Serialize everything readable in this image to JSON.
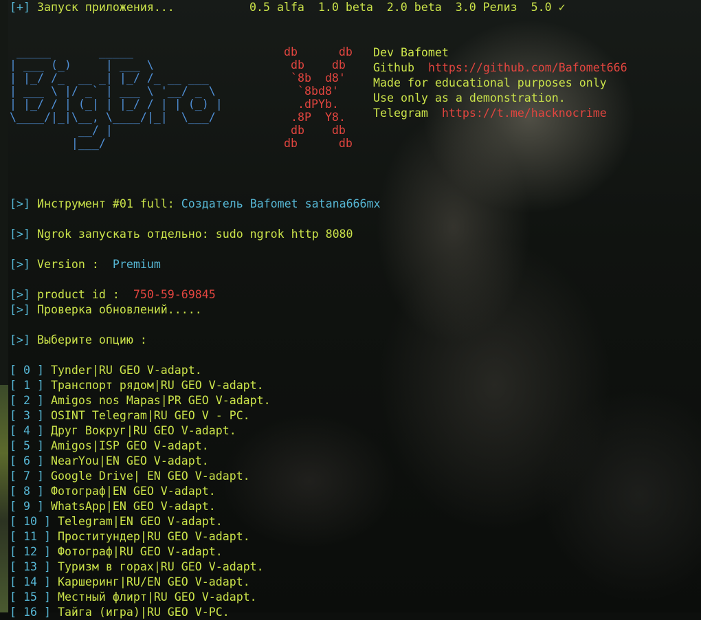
{
  "header": {
    "prefix": "[+]",
    "starting": "Запуск приложения...",
    "versions": "0.5 alfa  1.0 beta  2.0 beta  3.0 Релиз  5.0 ✓"
  },
  "logo_ascii": " _____       _____\n| ___ (_)     | ___ \\\n| |_/ /_  __ _| |_/ /_ __ ___\n| ___ \\ |/ _` | ___ \\ '__/ _ \\\n| |_/ / | (_| | |_/ / | | (_) |\n\\____/|_|\\__, \\____/|_|  \\___/\n          __/ |\n         |___/",
  "db_art": "db      db\n db    db\n `8b  d8'\n  `8bd8'\n  .dPYb.\n .8P  Y8.\n db    db\ndb      db",
  "info": {
    "dev": "Dev Bafomet",
    "github_label": "Github",
    "github_url": "https://github.com/Bafomet666",
    "purpose": "Made for educational purposes only",
    "demo": "Use only as a demonstration.",
    "telegram_label": "Telegram",
    "telegram_url": "https://t.me/hacknocrime"
  },
  "status": {
    "prefix": "[>]",
    "tool_label": "Инструмент #01 full:",
    "tool_value": "Создатель Bafomet satana666mx",
    "ngrok": "Ngrok запускать отдельно: sudo ngrok http 8080",
    "version_label": "Version :",
    "version_value": "Premium",
    "product_label": "product id :",
    "product_value": "750-59-69845",
    "updates": "Проверка обновлений.....",
    "choose": "Выберите опцию :"
  },
  "options": [
    {
      "num": "[ 0 ]",
      "label": "Tynder|RU GEO V-adapt."
    },
    {
      "num": "[ 1 ]",
      "label": "Транспорт рядом|RU GEO V-adapt."
    },
    {
      "num": "[ 2 ]",
      "label": "Amigos nos Mapas|PR GEO V-adapt."
    },
    {
      "num": "[ 3 ]",
      "label": "OSINT Telegram|RU GEO V - PC."
    },
    {
      "num": "[ 4 ]",
      "label": "Друг Вокруг|RU GEO V-adapt."
    },
    {
      "num": "[ 5 ]",
      "label": "Amigos|ISP GEO V-adapt."
    },
    {
      "num": "[ 6 ]",
      "label": "NearYou|EN GEO V-adapt."
    },
    {
      "num": "[ 7 ]",
      "label": "Google Drive| EN GEO V-adapt."
    },
    {
      "num": "[ 8 ]",
      "label": "Фотограф|EN GEO V-adapt."
    },
    {
      "num": "[ 9 ]",
      "label": "WhatsApp|EN GEO V-adapt."
    },
    {
      "num": "[ 10 ]",
      "label": "Telegram|EN GEO V-adapt."
    },
    {
      "num": "[ 11 ]",
      "label": "Проститундер|RU GEO V-adapt."
    },
    {
      "num": "[ 12 ]",
      "label": "Фотограф|RU GEO V-adapt."
    },
    {
      "num": "[ 13 ]",
      "label": "Туризм в горах|RU GEO V-adapt."
    },
    {
      "num": "[ 14 ]",
      "label": "Каршеринг|RU/EN GEO V-adapt."
    },
    {
      "num": "[ 15 ]",
      "label": "Местный флирт|RU GEO V-adapt."
    },
    {
      "num": "[ 16 ]",
      "label": "Тайга (игра)|RU GEO V-PC."
    }
  ],
  "colors": {
    "green": "#cbe34a",
    "cyan": "#56b6d4",
    "red": "#e2453f",
    "blue": "#4f8fd6",
    "background": "#0d0f0d"
  }
}
